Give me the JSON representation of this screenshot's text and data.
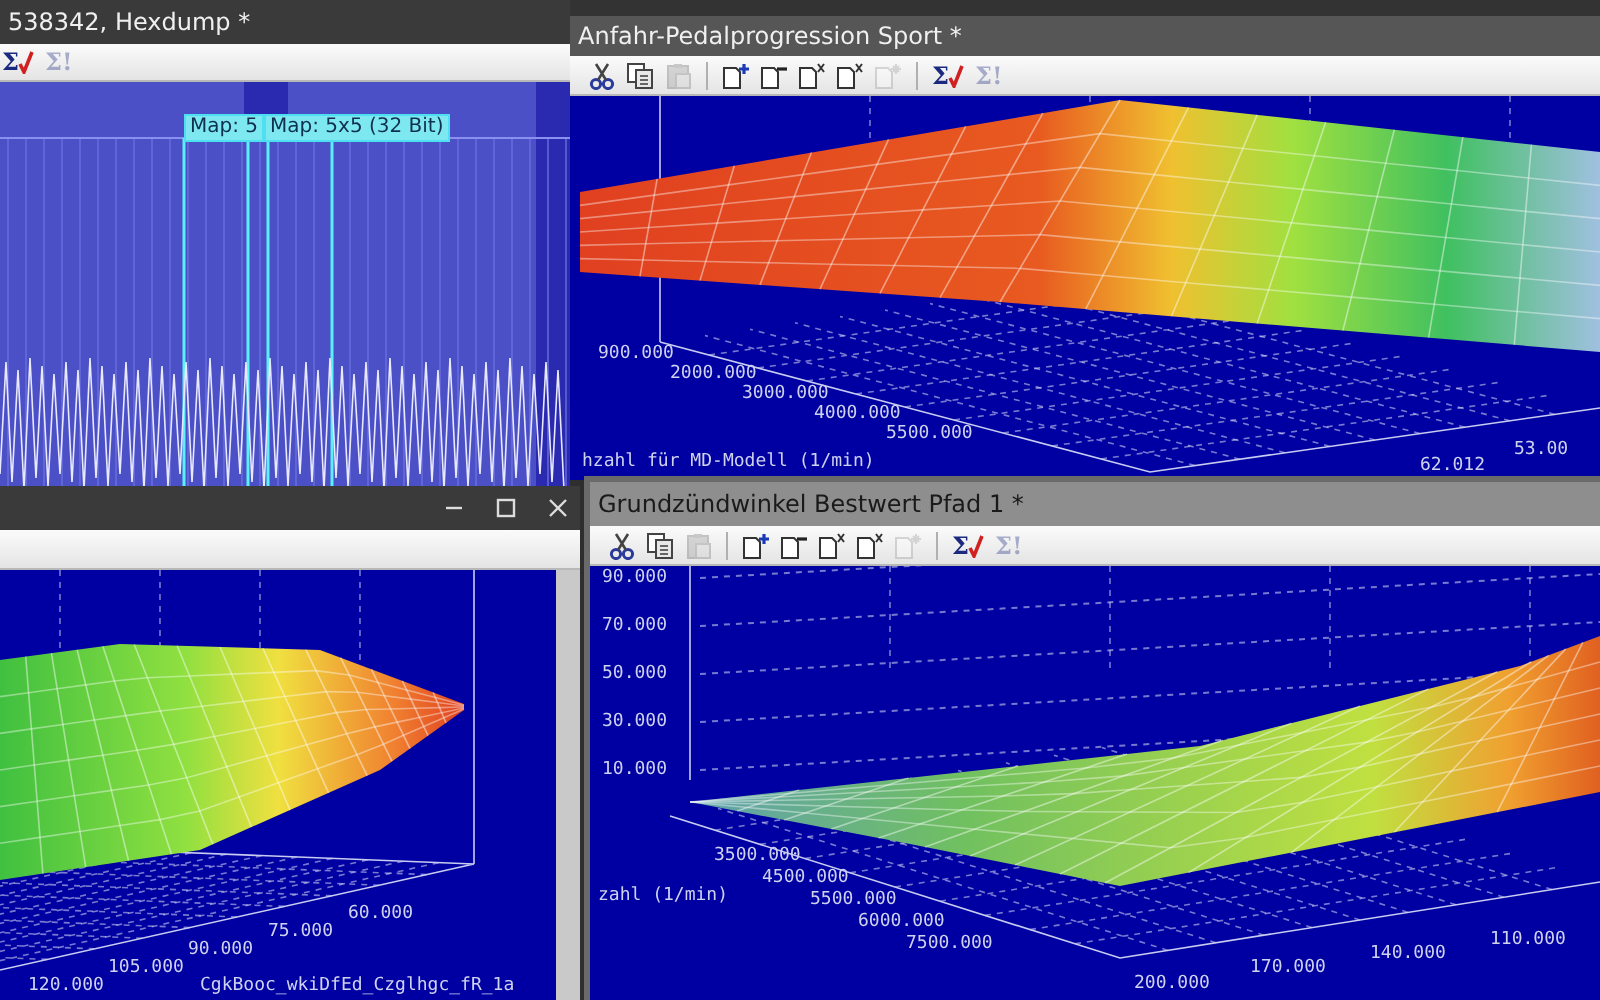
{
  "windows": [
    {
      "kind": "hexdump",
      "title": "538342, Hexdump *",
      "active": false,
      "controls": false,
      "toolbar": [
        {
          "kind": "sigma-check",
          "label": "Σ",
          "disabled": false
        },
        {
          "kind": "sigma",
          "label": "Σ!",
          "disabled": true
        }
      ],
      "map_labels": [
        "Map: 5",
        "Map: 5x5 (32 Bit)"
      ]
    },
    {
      "kind": "map3d",
      "title": "Anfahr-Pedalprogression Sport *",
      "active": false,
      "controls": false,
      "toolbar": [
        {
          "kind": "cut",
          "disabled": false
        },
        {
          "kind": "copy",
          "disabled": false
        },
        {
          "kind": "paste",
          "disabled": true
        },
        {
          "kind": "separator"
        },
        {
          "kind": "doc-plus",
          "disabled": false
        },
        {
          "kind": "doc-minus",
          "disabled": false
        },
        {
          "kind": "doc-x",
          "disabled": false
        },
        {
          "kind": "doc-x",
          "disabled": false
        },
        {
          "kind": "doc-star",
          "disabled": true
        },
        {
          "kind": "separator"
        },
        {
          "kind": "sigma-check",
          "label": "Σ",
          "disabled": false
        },
        {
          "kind": "sigma",
          "label": "Σ!",
          "disabled": true
        }
      ],
      "x_ticks": [
        "900.000",
        "2000.000",
        "3000.000",
        "4000.000",
        "5500.000"
      ],
      "x_title": "hzahl für MD-Modell (1/min)",
      "y_ticks": [
        "62.012",
        "53.00"
      ]
    },
    {
      "kind": "map3d",
      "active": false,
      "controls": true,
      "x_ticks": [
        "120.000",
        "105.000",
        "90.000",
        "75.000",
        "60.000"
      ],
      "x_title": "CgkBooc_wkiDfEd_Czglhgc_fR_1a"
    },
    {
      "kind": "map3d",
      "title": "Grundzündwinkel Bestwert Pfad 1 *",
      "active": true,
      "controls": false,
      "toolbar": [
        {
          "kind": "cut",
          "disabled": false
        },
        {
          "kind": "copy",
          "disabled": false
        },
        {
          "kind": "paste",
          "disabled": true
        },
        {
          "kind": "separator"
        },
        {
          "kind": "doc-plus",
          "disabled": false
        },
        {
          "kind": "doc-minus",
          "disabled": false
        },
        {
          "kind": "doc-x",
          "disabled": false
        },
        {
          "kind": "doc-x",
          "disabled": false
        },
        {
          "kind": "doc-star",
          "disabled": true
        },
        {
          "kind": "separator"
        },
        {
          "kind": "sigma-check",
          "label": "Σ",
          "disabled": false
        },
        {
          "kind": "sigma",
          "label": "Σ!",
          "disabled": true
        }
      ],
      "z_ticks": [
        "90.000",
        "70.000",
        "50.000",
        "30.000",
        "10.000"
      ],
      "x_ticks": [
        "3500.000",
        "4500.000",
        "5500.000",
        "6000.000",
        "7500.000"
      ],
      "x_title": "zahl (1/min)",
      "y_ticks": [
        "200.000",
        "170.000",
        "140.000",
        "110.000"
      ]
    }
  ]
}
